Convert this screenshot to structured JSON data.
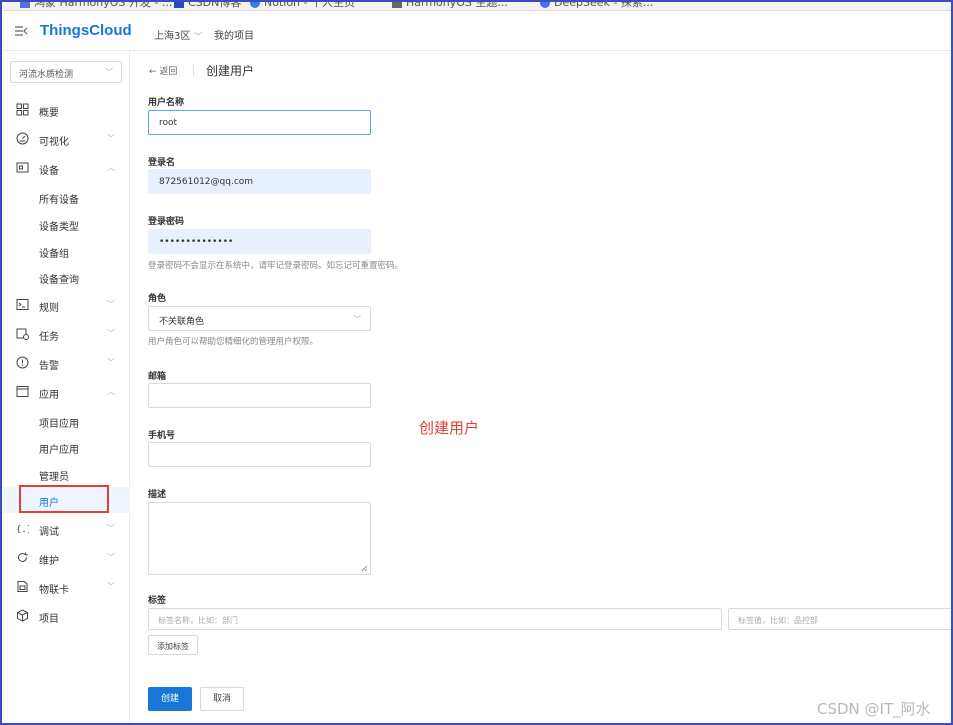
{
  "bookmarks": [
    "鸿蒙 HarmonyOS 开发 - ...",
    "CSDN博客",
    "Notion - 个人主页",
    "HarmonyOS 主题...",
    "DeepSeek - 探索..."
  ],
  "header": {
    "brand": "ThingsCloud",
    "region": "上海3区",
    "project_nav": "我的项目"
  },
  "sidebar": {
    "project": "河流水质检测",
    "items": [
      {
        "label": "概要",
        "icon": "dashboard-icon"
      },
      {
        "label": "可视化",
        "icon": "gauge-icon"
      },
      {
        "label": "设备",
        "icon": "device-icon"
      },
      {
        "label": "规则",
        "icon": "terminal-icon"
      },
      {
        "label": "任务",
        "icon": "task-icon"
      },
      {
        "label": "告警",
        "icon": "alert-icon"
      },
      {
        "label": "应用",
        "icon": "window-icon"
      },
      {
        "label": "调试",
        "icon": "braces-icon"
      },
      {
        "label": "维护",
        "icon": "refresh-icon"
      },
      {
        "label": "物联卡",
        "icon": "simcard-icon"
      },
      {
        "label": "项目",
        "icon": "cube-icon"
      }
    ],
    "device_sub": [
      "所有设备",
      "设备类型",
      "设备组",
      "设备查询"
    ],
    "app_sub": [
      "项目应用",
      "用户应用",
      "管理员",
      "用户"
    ]
  },
  "page": {
    "back": "← 返回",
    "title": "创建用户"
  },
  "form": {
    "username_label": "用户名称",
    "username_value": "root",
    "login_label": "登录名",
    "login_value": "872561012@qq.com",
    "password_label": "登录密码",
    "password_value": "••••••••••••••",
    "password_hint": "登录密码不会显示在系统中，请牢记登录密码。如忘记可重置密码。",
    "role_label": "角色",
    "role_value": "不关联角色",
    "role_hint": "用户角色可以帮助您精细化的管理用户权限。",
    "email_label": "邮箱",
    "phone_label": "手机号",
    "desc_label": "描述",
    "tags_label": "标签",
    "tag_name_placeholder": "标签名称，比如：部门",
    "tag_value_placeholder": "标签值，比如：品控部",
    "add_tag": "添加标签",
    "submit": "创建",
    "cancel": "取消"
  },
  "annotation": "创建用户",
  "watermark": "CSDN @IT_阿水",
  "colors": {
    "accent": "#1677d8",
    "annotation": "#e0403a",
    "frame": "#3a4cc0"
  }
}
